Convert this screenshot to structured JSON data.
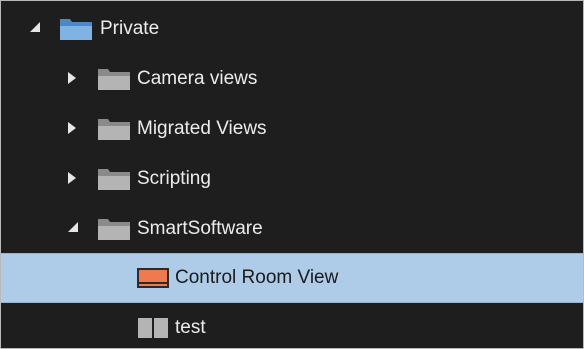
{
  "tree": {
    "items": [
      {
        "label": "Private",
        "level": 0,
        "state": "expanded",
        "icon": "folder-open-icon"
      },
      {
        "label": "Camera views",
        "level": 1,
        "state": "collapsed",
        "icon": "folder-icon"
      },
      {
        "label": "Migrated Views",
        "level": 1,
        "state": "collapsed",
        "icon": "folder-icon"
      },
      {
        "label": "Scripting",
        "level": 1,
        "state": "collapsed",
        "icon": "folder-icon"
      },
      {
        "label": "SmartSoftware",
        "level": 1,
        "state": "expanded",
        "icon": "folder-icon"
      },
      {
        "label": "Control Room View",
        "level": 2,
        "state": "leaf",
        "icon": "view-layout-icon",
        "selected": true
      },
      {
        "label": "test",
        "level": 2,
        "state": "leaf",
        "icon": "view-grid-icon"
      }
    ]
  },
  "colors": {
    "background": "#1e1e1e",
    "text": "#ececec",
    "selection": "#aecbe8",
    "folder_blue": "#7fb3e3",
    "folder_gray": "#b4b4b4",
    "view_icon_accent": "#f07a50"
  }
}
